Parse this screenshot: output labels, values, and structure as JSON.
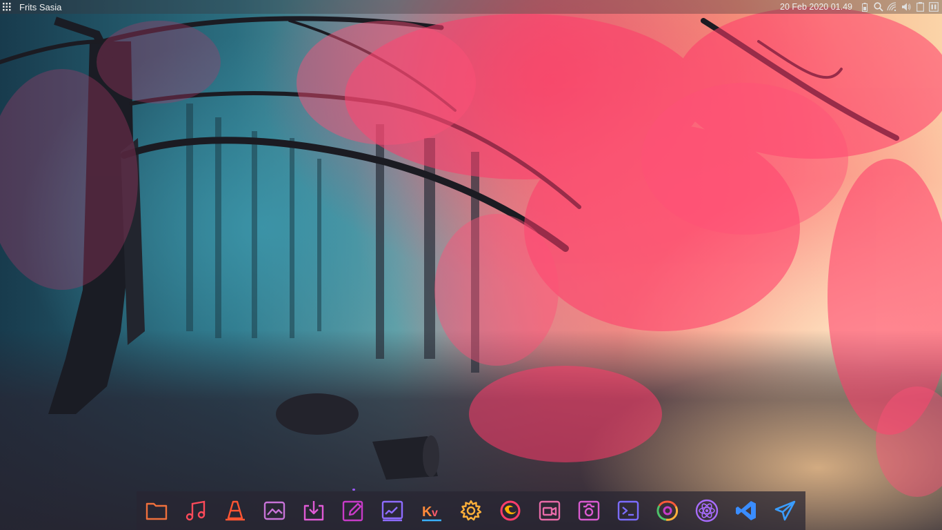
{
  "panel": {
    "user_name": "Frits Sasia",
    "clock": "20 Feb 2020 01.49",
    "launcher_icon": "app-grid-icon",
    "tray_icons": [
      "battery-icon",
      "search-icon",
      "network-icon",
      "volume-icon",
      "clipboard-icon",
      "window-switcher-icon"
    ]
  },
  "dock": {
    "items": [
      {
        "id": "files",
        "icon": "folder-icon",
        "color": "#f0703c"
      },
      {
        "id": "music",
        "icon": "music-note-icon",
        "color": "#ff4a5a"
      },
      {
        "id": "vlc",
        "icon": "traffic-cone-icon",
        "color": "#ff5533"
      },
      {
        "id": "image-viewer",
        "icon": "image-icon",
        "color": "#c873d8"
      },
      {
        "id": "software-center",
        "icon": "download-box-icon",
        "color": "#e05ad5"
      },
      {
        "id": "text-editor",
        "icon": "edit-icon",
        "color": "#c83bc8"
      },
      {
        "id": "screenshot",
        "icon": "screenshot-icon",
        "color": "#8e6cff"
      },
      {
        "id": "kv",
        "icon": "kv-text-icon",
        "color": "#ff8a3a",
        "label": "Kv"
      },
      {
        "id": "settings",
        "icon": "gear-icon",
        "color": "#ffb13a"
      },
      {
        "id": "firefox",
        "icon": "firefox-icon",
        "color": "#ff3d6b"
      },
      {
        "id": "video-recorder",
        "icon": "video-camera-icon",
        "color": "#e86aa8"
      },
      {
        "id": "camera",
        "icon": "camera-icon",
        "color": "#d95ad0"
      },
      {
        "id": "terminal",
        "icon": "terminal-icon",
        "color": "#7b6cff"
      },
      {
        "id": "chrome",
        "icon": "chrome-icon",
        "color": "#ff9a2e"
      },
      {
        "id": "atom",
        "icon": "atom-icon",
        "color": "#a86cff"
      },
      {
        "id": "vscode",
        "icon": "vscode-icon",
        "color": "#3a8dff"
      },
      {
        "id": "telegram",
        "icon": "telegram-icon",
        "color": "#3a9dff"
      }
    ]
  },
  "colors": {
    "topbar_text": "#f2f2f2",
    "accent_orange": "#ff7a3a",
    "accent_pink": "#e0408a",
    "accent_purple": "#8e6cff",
    "accent_blue": "#3a8dff"
  }
}
